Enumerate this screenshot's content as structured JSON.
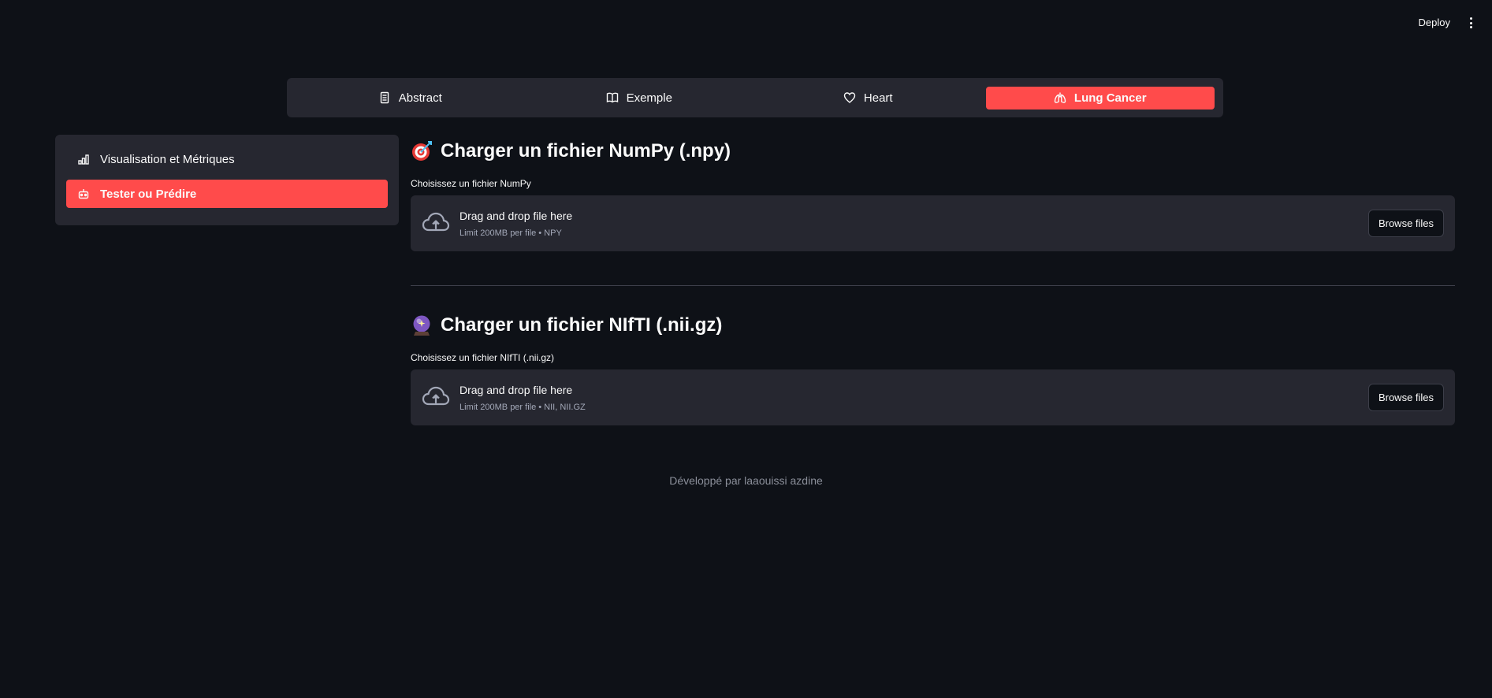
{
  "header": {
    "deploy_label": "Deploy",
    "menu_icon": "kebab-menu-icon"
  },
  "nav": {
    "items": [
      {
        "label": "Abstract",
        "icon": "document-icon"
      },
      {
        "label": "Exemple",
        "icon": "book-icon"
      },
      {
        "label": "Heart",
        "icon": "heart-icon"
      },
      {
        "label": "Lung Cancer",
        "icon": "lungs-icon",
        "active": true
      }
    ]
  },
  "sidebar": {
    "items": [
      {
        "label": "Visualisation et Métriques",
        "icon": "bar-chart-icon"
      },
      {
        "label": "Tester ou Prédire",
        "icon": "robot-icon",
        "active": true
      }
    ]
  },
  "sections": [
    {
      "title": "Charger un fichier NumPy (.npy)",
      "emoji": "target-icon",
      "field_label": "Choisissez un fichier NumPy",
      "dropzone_text": "Drag and drop file here",
      "dropzone_limit": "Limit 200MB per file • NPY",
      "button_label": "Browse files"
    },
    {
      "title": "Charger un fichier NIfTI (.nii.gz)",
      "emoji": "crystal-ball-icon",
      "field_label": "Choisissez un fichier NIfTI (.nii.gz)",
      "dropzone_text": "Drag and drop file here",
      "dropzone_limit": "Limit 200MB per file • NII, NII.GZ",
      "button_label": "Browse files"
    }
  ],
  "footer": {
    "text": "Développé par laaouissi azdine"
  },
  "colors": {
    "background": "#0e1117",
    "panel": "#262730",
    "accent": "#ff4b4b"
  }
}
